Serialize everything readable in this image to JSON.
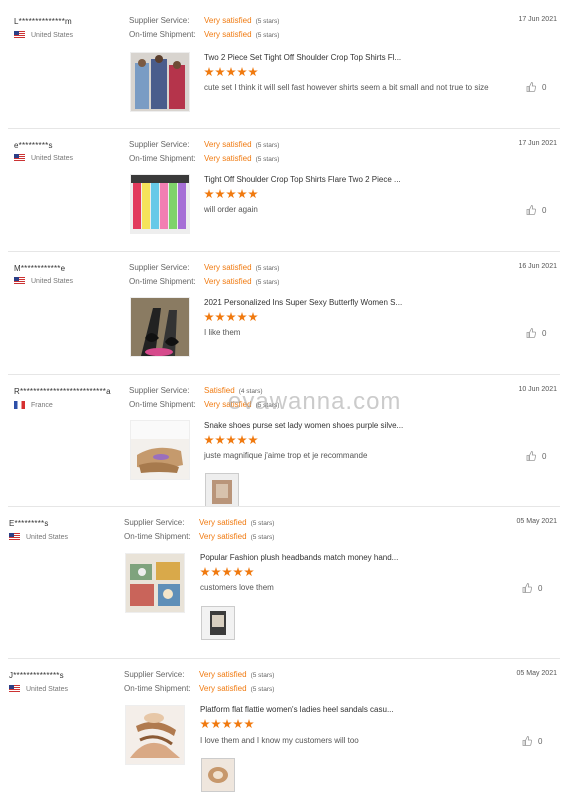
{
  "labels": {
    "supplier_service": "Supplier Service:",
    "ontime_shipment": "On-time Shipment:"
  },
  "watermark": "evawanna.com",
  "accent_color": "#f07a10",
  "reviews": [
    {
      "user": "L**************m",
      "country": "United States",
      "flag": "us",
      "supplier": "Very satisfied",
      "supplier_stars": "(5 stars)",
      "shipment": "Very satisfied",
      "shipment_stars": "(5 stars)",
      "date": "17 Jun 2021",
      "product": "Two 2 Piece Set Tight Off Shoulder Crop Top Shirts Fl...",
      "rating": 5,
      "comment": "cute set I think it will sell fast however shirts seem a bit small and not true to size",
      "likes": "0"
    },
    {
      "user": "e*********s",
      "country": "United States",
      "flag": "us",
      "supplier": "Very satisfied",
      "supplier_stars": "(5 stars)",
      "shipment": "Very satisfied",
      "shipment_stars": "(5 stars)",
      "date": "17 Jun 2021",
      "product": "Tight Off Shoulder Crop Top Shirts Flare Two 2 Piece ...",
      "rating": 5,
      "comment": "will order again",
      "likes": "0"
    },
    {
      "user": "M************e",
      "country": "United States",
      "flag": "us",
      "supplier": "Very satisfied",
      "supplier_stars": "(5 stars)",
      "shipment": "Very satisfied",
      "shipment_stars": "(5 stars)",
      "date": "16 Jun 2021",
      "product": "2021 Personalized Ins Super Sexy Butterfly Women S...",
      "rating": 5,
      "comment": "I like them",
      "likes": "0"
    },
    {
      "user": "R**************************a",
      "country": "France",
      "flag": "fr",
      "supplier": "Satisfied",
      "supplier_stars": "(4 stars)",
      "shipment": "Very satisfied",
      "shipment_stars": "(5 stars)",
      "date": "10 Jun 2021",
      "product": "Snake shoes purse set lady women shoes purple silve...",
      "rating": 5,
      "comment": "juste magnifique j'aime trop et je recommande",
      "likes": "0"
    },
    {
      "user": "E*********s",
      "country": "United States",
      "flag": "us",
      "supplier": "Very satisfied",
      "supplier_stars": "(5 stars)",
      "shipment": "Very satisfied",
      "shipment_stars": "(5 stars)",
      "date": "05 May 2021",
      "product": "Popular Fashion plush headbands match money hand...",
      "rating": 5,
      "comment": "customers love them",
      "likes": "0"
    },
    {
      "user": "J**************s",
      "country": "United States",
      "flag": "us",
      "supplier": "Very satisfied",
      "supplier_stars": "(5 stars)",
      "shipment": "Very satisfied",
      "shipment_stars": "(5 stars)",
      "date": "05 May 2021",
      "product": "Platform flat flattie women's ladies heel sandals casu...",
      "rating": 5,
      "comment": "I love them and I know my customers will too",
      "likes": "0"
    }
  ]
}
